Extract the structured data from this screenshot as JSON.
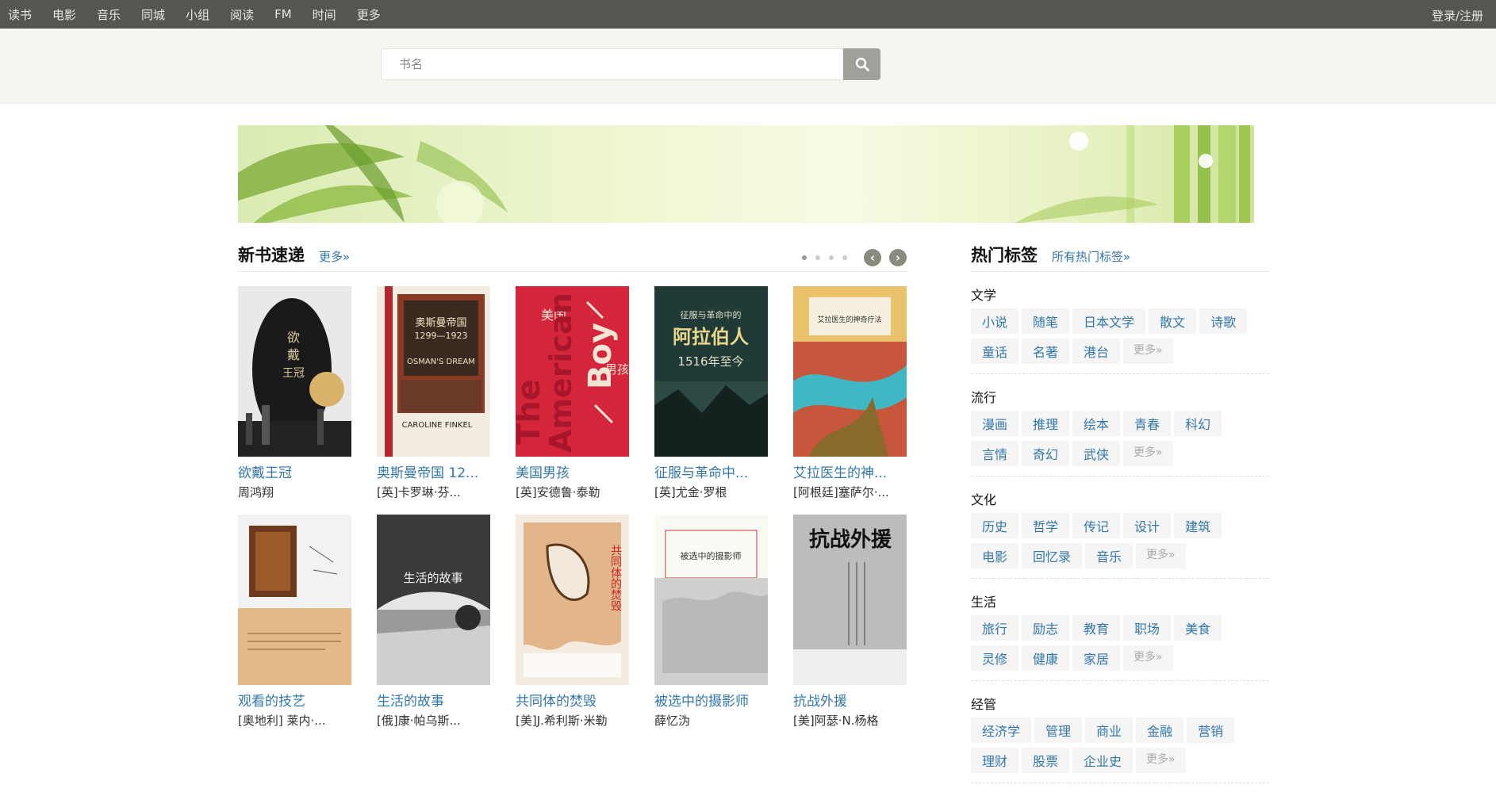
{
  "nav": {
    "items": [
      "读书",
      "电影",
      "音乐",
      "同城",
      "小组",
      "阅读",
      "FM",
      "时间",
      "更多"
    ],
    "login": "登录/注册"
  },
  "search": {
    "placeholder": "书名"
  },
  "newbooks": {
    "title": "新书速递",
    "more": "更多»",
    "page_count": 4,
    "active_page": 1,
    "books": [
      {
        "title": "欲戴王冠",
        "author": "周鸿翔"
      },
      {
        "title": "奥斯曼帝国 12...",
        "author": "[英]卡罗琳·芬..."
      },
      {
        "title": "美国男孩",
        "author": "[英]安德鲁·泰勒"
      },
      {
        "title": "征服与革命中...",
        "author": "[英]尤金·罗根"
      },
      {
        "title": "艾拉医生的神...",
        "author": "[阿根廷]塞萨尔·..."
      },
      {
        "title": "观看的技艺",
        "author": "[奥地利] 莱内·..."
      },
      {
        "title": "生活的故事",
        "author": "[俄]康·帕乌斯..."
      },
      {
        "title": "共同体的焚毁",
        "author": "[美]J.希利斯·米勒"
      },
      {
        "title": "被选中的摄影师",
        "author": "薛忆沩"
      },
      {
        "title": "抗战外援",
        "author": "[美]阿瑟·N.杨格"
      }
    ]
  },
  "hottags": {
    "title": "热门标签",
    "more": "所有热门标签»",
    "categories": [
      {
        "name": "文学",
        "tags": [
          "小说",
          "随笔",
          "日本文学",
          "散文",
          "诗歌",
          "童话",
          "名著",
          "港台"
        ],
        "more": "更多»"
      },
      {
        "name": "流行",
        "tags": [
          "漫画",
          "推理",
          "绘本",
          "青春",
          "科幻",
          "言情",
          "奇幻",
          "武侠"
        ],
        "more": "更多»"
      },
      {
        "name": "文化",
        "tags": [
          "历史",
          "哲学",
          "传记",
          "设计",
          "建筑",
          "电影",
          "回忆录",
          "音乐"
        ],
        "more": "更多»"
      },
      {
        "name": "生活",
        "tags": [
          "旅行",
          "励志",
          "教育",
          "职场",
          "美食",
          "灵修",
          "健康",
          "家居"
        ],
        "more": "更多»"
      },
      {
        "name": "经管",
        "tags": [
          "经济学",
          "管理",
          "商业",
          "金融",
          "营销",
          "理财",
          "股票",
          "企业史"
        ],
        "more": "更多»"
      }
    ]
  },
  "covers": {
    "c1": {
      "top": "欲",
      "mid": "戴",
      "bot": "王冠"
    },
    "c2": {
      "title": "奥斯曼帝国",
      "years": "1299—1923",
      "en": "OSMAN'S DREAM",
      "author": "CAROLINE FINKEL"
    },
    "c3": {
      "cn": "美国",
      "en1": "The",
      "en2": "American",
      "en3": "Boy",
      "cn2": "男孩"
    },
    "c4": {
      "t1": "征服与革命中的",
      "t2": "阿拉伯人",
      "t3": "1516年至今"
    },
    "c5": {
      "t1": "艾拉医生的神奇疗法"
    },
    "c7": {
      "t1": "生活的故事"
    },
    "c8": {
      "t1": "共同体的焚毁"
    },
    "c9": {
      "t1": "被选中的摄影师"
    },
    "c10": {
      "t1": "抗战外援"
    }
  }
}
